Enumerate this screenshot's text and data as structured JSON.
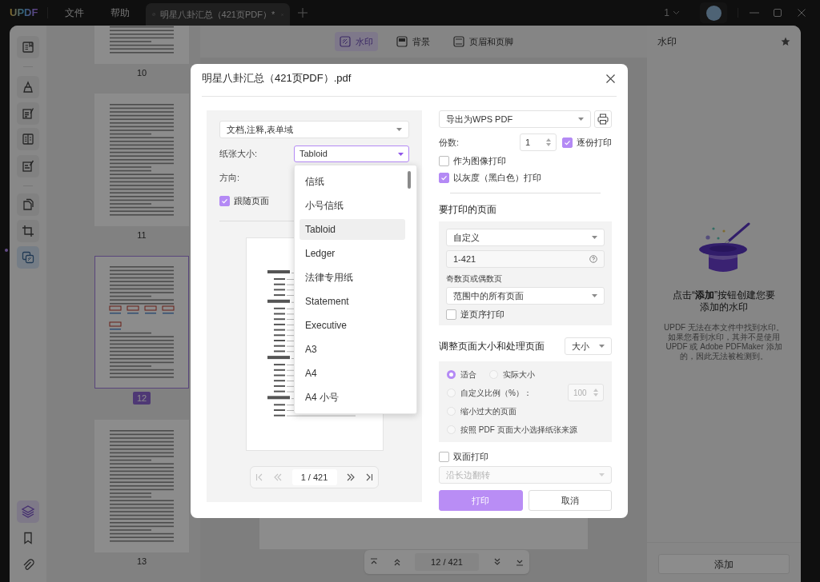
{
  "title_bar": {
    "logo": "UPDF",
    "menus": [
      "文件",
      "帮助"
    ],
    "tab": {
      "title": "明星八卦汇总（421页PDF）*"
    },
    "page_count": "1"
  },
  "left_tools": [
    {
      "selected": false
    },
    {
      "selected": false
    },
    {
      "selected": false
    },
    {
      "selected": false
    },
    {
      "selected": false
    },
    {
      "selected": false
    },
    {
      "selected": false
    },
    {
      "selected": true
    }
  ],
  "bottom_tools": [
    {
      "selected": true
    },
    {
      "selected": false
    },
    {
      "selected": false
    }
  ],
  "thumbnails": [
    {
      "label": "10",
      "selected": false
    },
    {
      "label": "11",
      "selected": false
    },
    {
      "label": "12",
      "selected": true
    },
    {
      "label": "13",
      "selected": false
    }
  ],
  "doc_toolbar": [
    {
      "label": "水印",
      "selected": true
    },
    {
      "label": "背景",
      "selected": false
    },
    {
      "label": "页眉和页脚",
      "selected": false
    }
  ],
  "page_nav": {
    "text": "12 / 421"
  },
  "right_panel": {
    "title": "水印",
    "empty_title": "点击“**添加**”按钮创建您要添加的水印",
    "empty_text": "UPDF 无法在本文件中找到水印。如果您看到水印，其并不是使用 UPDF 或 Adobe PDFMaker 添加的，因此无法被检测到。",
    "add_button": "添加"
  },
  "dialog": {
    "title": "明星八卦汇总（421页PDF）.pdf",
    "content_select": "文档,注释,表单域",
    "paper_size": {
      "label": "纸张大小:",
      "value": "Tabloid",
      "expanded": true,
      "options": [
        {
          "label": "信纸",
          "selected": false
        },
        {
          "label": "小号信纸",
          "selected": false
        },
        {
          "label": "Tabloid",
          "selected": true
        },
        {
          "label": "Ledger",
          "selected": false
        },
        {
          "label": "法律专用纸",
          "selected": false
        },
        {
          "label": "Statement",
          "selected": false
        },
        {
          "label": "Executive",
          "selected": false
        },
        {
          "label": "A3",
          "selected": false
        },
        {
          "label": "A4",
          "selected": false
        },
        {
          "label": "A4 小号",
          "selected": false
        }
      ]
    },
    "orientation": {
      "label": "方向:"
    },
    "follow_page": {
      "label": "跟随页面",
      "checked": true
    },
    "preview_pager": {
      "text": "1 / 421"
    },
    "printer": {
      "value": "导出为WPS PDF"
    },
    "copies": {
      "label": "份数:",
      "value": "1"
    },
    "collate": {
      "label": "逐份打印",
      "checked": true
    },
    "print_as_image": {
      "label": "作为图像打印",
      "checked": false
    },
    "grayscale": {
      "label": "以灰度（黑白色）打印",
      "checked": true
    },
    "pages_section": {
      "title": "要打印的页面",
      "range_select": "自定义",
      "range": "1-421",
      "subset_label": "奇数页或偶数页",
      "subset_select": "范围中的所有页面",
      "reverse": {
        "label": "逆页序打印",
        "checked": false
      }
    },
    "sizing_section": {
      "title": "调整页面大小和处理页面",
      "mode": "大小",
      "rows": [
        [
          {
            "label": "适合",
            "selected": true
          },
          {
            "label": "实际大小",
            "selected": false
          }
        ],
        [
          {
            "label": "自定义比例（%）：",
            "selected": false,
            "field": {
              "value": "100",
              "disabled": true
            }
          }
        ],
        [
          {
            "label": "缩小过大的页面",
            "selected": false
          }
        ],
        [
          {
            "label": "按照 PDF 页面大小选择纸张来源",
            "selected": false
          }
        ]
      ]
    },
    "duplex": {
      "label": "双面打印",
      "checked": false
    },
    "flip": {
      "value": "沿长边翻转",
      "disabled": true
    },
    "buttons": [
      {
        "label": "打印",
        "kind": "primary"
      },
      {
        "label": "取消",
        "kind": "secondary"
      }
    ]
  }
}
